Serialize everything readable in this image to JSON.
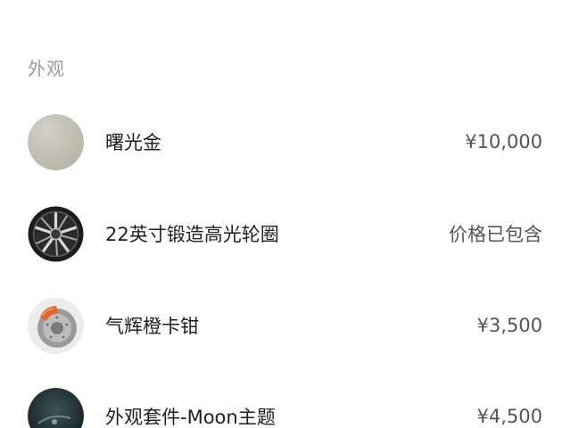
{
  "section": {
    "title": "外观"
  },
  "options": [
    {
      "name": "曙光金",
      "price": "¥10,000",
      "icon": "paint-swatch-icon",
      "swatch_color": "#c5c1b7"
    },
    {
      "name": "22英寸锻造高光轮圈",
      "price": "价格已包含",
      "icon": "wheel-rim-icon"
    },
    {
      "name": "气辉橙卡钳",
      "price": "¥3,500",
      "icon": "brake-caliper-icon",
      "caliper_color": "#e8632a"
    },
    {
      "name": "外观套件-Moon主题",
      "price": "¥4,500",
      "icon": "moon-theme-kit-icon"
    }
  ]
}
